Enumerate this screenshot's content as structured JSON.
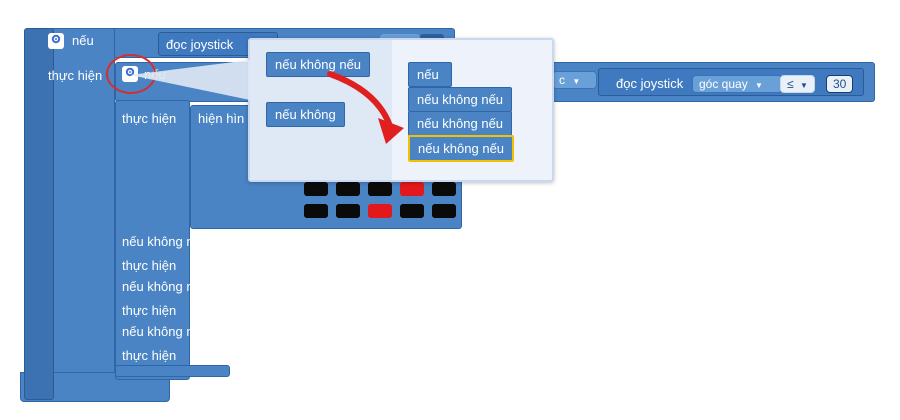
{
  "workspace": {
    "if_label": "nếu",
    "do_label": "thực hiện",
    "read_joystick": "đọc joystick",
    "rotation_read_joystick": "đọc joystick",
    "rotation_dropdown": "góc quay",
    "operator": "≤",
    "value": "30",
    "partial_dropdown": "c",
    "inner_if_label": "nếu",
    "inner_do_label": "thực hiện",
    "show_image_label": "hiện hìn",
    "else_if_1": "nếu không nếu",
    "do_1": "thực hiện",
    "else_if_2": "nếu không nếu",
    "do_2": "thực hiện",
    "else_if_3": "nếu không nếu",
    "do_3": "thực hiện"
  },
  "led_grid": {
    "rows": [
      [
        false,
        false,
        false,
        true,
        false
      ],
      [
        false,
        false,
        true,
        false,
        false
      ]
    ],
    "on_color": "#e2181c",
    "off_color": "#0a0a0a"
  },
  "mutator_popup": {
    "palette": [
      "nếu không nếu",
      "nếu không"
    ],
    "stack_header": "nếu",
    "stack_items": [
      "nếu không nếu",
      "nếu không nếu",
      "nếu không nếu"
    ]
  },
  "colors": {
    "block_blue": "#4a84c4",
    "highlight_yellow": "#f2c200",
    "arrow_red": "#e02020",
    "circle_red": "#d32f2f"
  },
  "icons": [
    "gear-icon",
    "dropdown-arrow-icon"
  ]
}
